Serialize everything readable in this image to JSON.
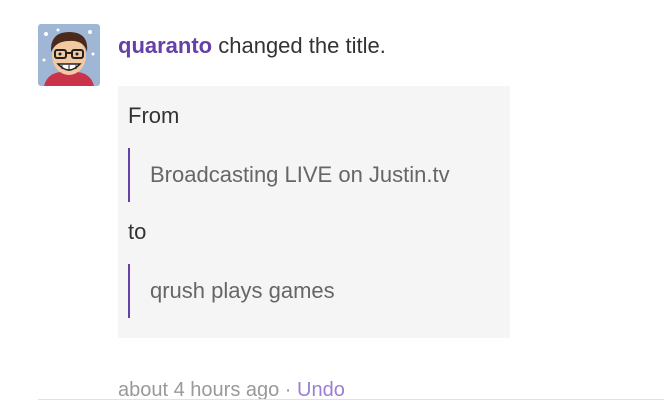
{
  "entry": {
    "actor": "quaranto",
    "action_text": " changed the title.",
    "from_label": "From",
    "old_title": "Broadcasting LIVE on Justin.tv",
    "to_label": "to",
    "new_title": "qrush plays games",
    "timestamp": "about 4 hours ago",
    "separator": " · ",
    "undo_label": "Undo",
    "avatar_icon": "cartoon-user-avatar-icon"
  },
  "colors": {
    "brand": "#6441a5",
    "undo_link": "#9b7fd4",
    "meta_text": "#999999",
    "box_background": "#f5f5f5"
  }
}
